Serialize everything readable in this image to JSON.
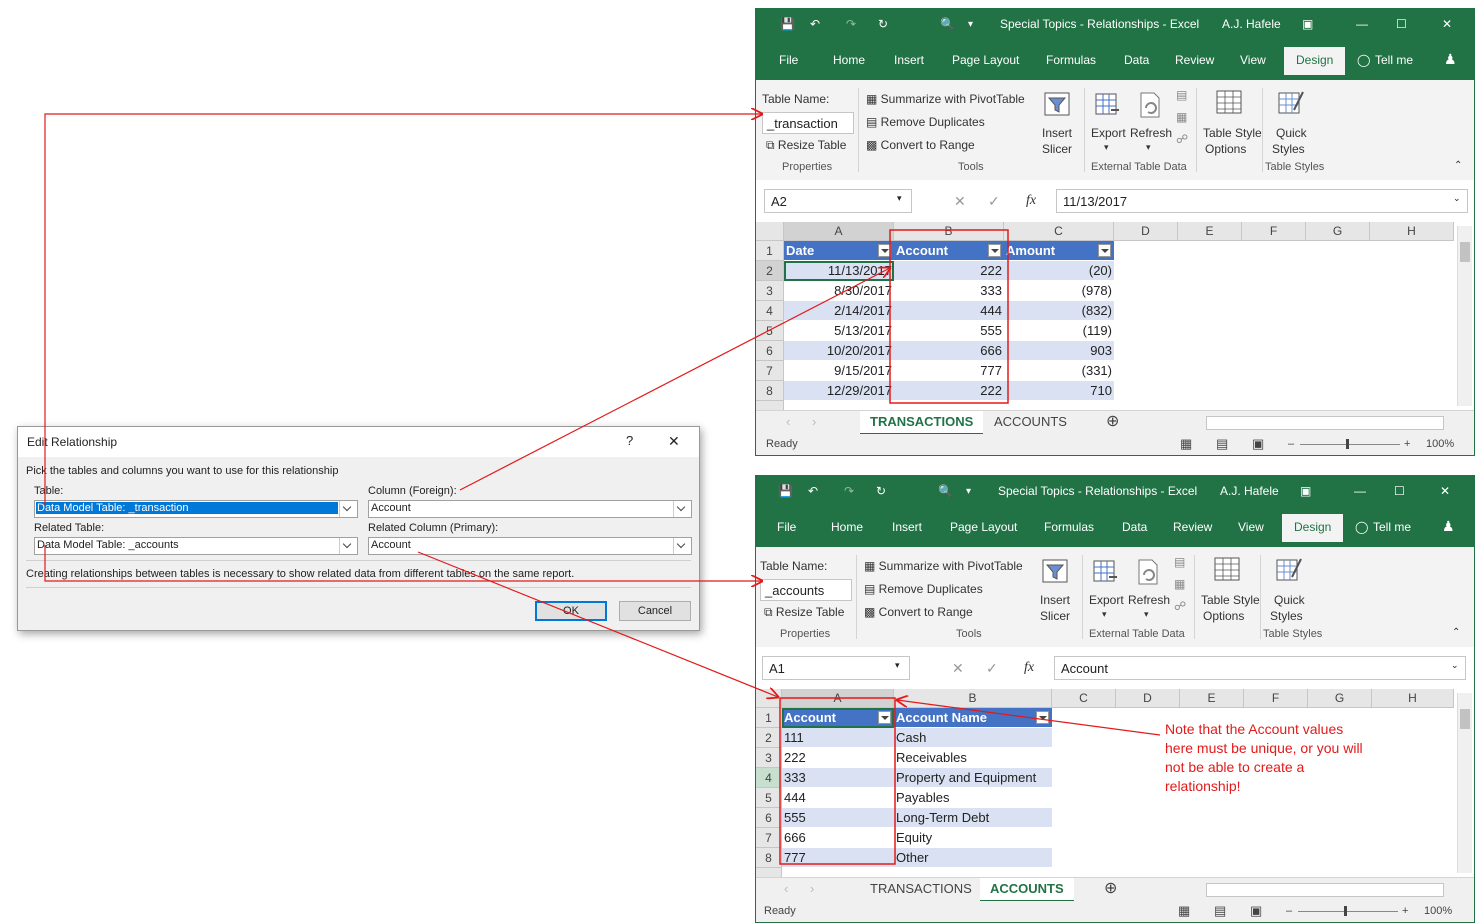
{
  "window1": {
    "title": "Special Topics - Relationships  -  Excel",
    "user": "A.J. Hafele",
    "menu": [
      "File",
      "Home",
      "Insert",
      "Page Layout",
      "Formulas",
      "Data",
      "Review",
      "View",
      "Design",
      "Tell me"
    ],
    "ribbon": {
      "table_name_label": "Table Name:",
      "table_name_value": "_transaction",
      "resize_table": "Resize Table",
      "properties_group": "Properties",
      "summarize": "Summarize with PivotTable",
      "remove_duplicates": "Remove Duplicates",
      "convert_to_range": "Convert to Range",
      "tools_group": "Tools",
      "insert_slicer_1": "Insert",
      "insert_slicer_2": "Slicer",
      "export": "Export",
      "refresh": "Refresh",
      "external_group": "External Table Data",
      "table_style_1": "Table Style",
      "table_style_2": "Options",
      "quick_1": "Quick",
      "quick_2": "Styles",
      "table_styles_group": "Table Styles"
    },
    "name_box": "A2",
    "formula": "11/13/2017",
    "columns": [
      "A",
      "B",
      "C",
      "D",
      "E",
      "F",
      "G",
      "H"
    ],
    "headers": [
      "Date",
      "Account",
      "Amount"
    ],
    "rows": [
      [
        "11/13/2017",
        "222",
        "(20)"
      ],
      [
        "8/30/2017",
        "333",
        "(978)"
      ],
      [
        "2/14/2017",
        "444",
        "(832)"
      ],
      [
        "5/13/2017",
        "555",
        "(119)"
      ],
      [
        "10/20/2017",
        "666",
        "903"
      ],
      [
        "9/15/2017",
        "777",
        "(331)"
      ],
      [
        "12/29/2017",
        "222",
        "710"
      ]
    ],
    "row_numbers": [
      "1",
      "2",
      "3",
      "4",
      "5",
      "6",
      "7",
      "8"
    ],
    "sheets": [
      "TRANSACTIONS",
      "ACCOUNTS"
    ],
    "active_sheet": "TRANSACTIONS",
    "status": "Ready",
    "zoom": "100%"
  },
  "window2": {
    "title": "Special Topics - Relationships  -  Excel",
    "user": "A.J. Hafele",
    "ribbon": {
      "table_name_value": "_accounts"
    },
    "name_box": "A1",
    "formula": "Account",
    "headers": [
      "Account",
      "Account Name"
    ],
    "rows": [
      [
        "111",
        "Cash"
      ],
      [
        "222",
        "Receivables"
      ],
      [
        "333",
        "Property and Equipment"
      ],
      [
        "444",
        "Payables"
      ],
      [
        "555",
        "Long-Term Debt"
      ],
      [
        "666",
        "Equity"
      ],
      [
        "777",
        "Other"
      ]
    ],
    "active_sheet": "ACCOUNTS",
    "status": "Ready",
    "zoom": "100%"
  },
  "dialog": {
    "title": "Edit Relationship",
    "help": "?",
    "close": "✕",
    "instruction": "Pick the tables and columns you want to use for this relationship",
    "table_label": "Table:",
    "table_value": "Data Model Table: _transaction",
    "column_label": "Column (Foreign):",
    "column_value": "Account",
    "related_table_label": "Related Table:",
    "related_table_value": "Data Model Table: _accounts",
    "related_column_label": "Related Column (Primary):",
    "related_column_value": "Account",
    "info": "Creating relationships between tables is necessary to show related data from different tables on the same report.",
    "ok": "OK",
    "cancel": "Cancel"
  },
  "note": "Note that the Account values here must be unique, or you will not be able to create a relationship!",
  "colors": {
    "excel_green": "#217346",
    "table_header": "#4472c4",
    "band": "#d9e1f2",
    "annotation_red": "#e21a1a"
  }
}
